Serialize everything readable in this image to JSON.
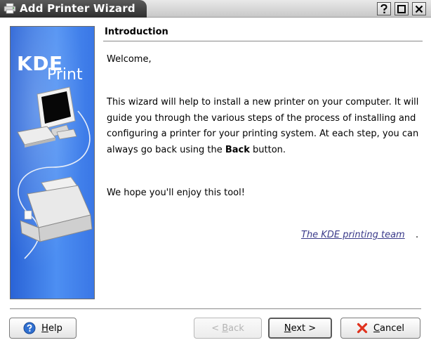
{
  "window": {
    "title": "Add Printer Wizard",
    "controls": [
      "help",
      "maximize",
      "close"
    ]
  },
  "banner": {
    "title": "KDE",
    "subtitle": "Print"
  },
  "page": {
    "section_title": "Introduction",
    "welcome": "Welcome,",
    "body_before_bold": "This wizard will help to install a new printer on your computer. It will guide you through the various steps of the process of installing and configuring a printer for your printing system. At each step, you can always go back using the ",
    "body_bold": "Back",
    "body_after_bold": " button.",
    "enjoy": "We hope you'll enjoy this tool!",
    "team_link": "The KDE printing team",
    "team_suffix": "."
  },
  "buttons": {
    "help": {
      "first": "H",
      "rest": "elp",
      "icon": "help-circle-icon"
    },
    "back": {
      "first": "< ",
      "mnemonic": "B",
      "rest": "ack",
      "enabled": false
    },
    "next": {
      "mnemonic": "N",
      "rest": "ext >"
    },
    "cancel": {
      "mnemonic": "C",
      "rest": "ancel",
      "icon": "cancel-x-icon"
    }
  },
  "colors": {
    "banner_blue": "#3a77e6",
    "link": "#3a3a8a",
    "cancel_red": "#e0321e",
    "help_blue": "#2f6fd0"
  }
}
